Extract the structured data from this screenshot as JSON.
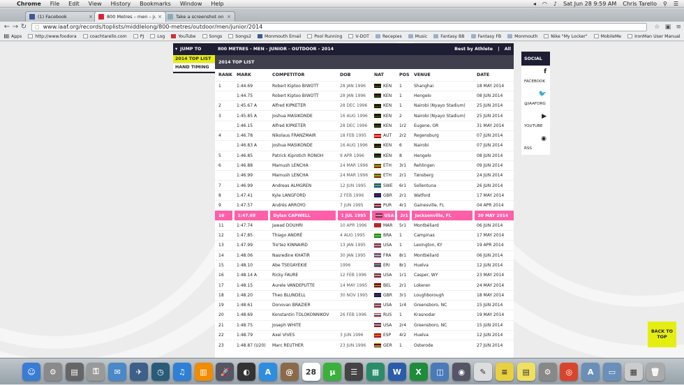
{
  "menubar": {
    "app": "Chrome",
    "items": [
      "File",
      "Edit",
      "View",
      "History",
      "Bookmarks",
      "Window",
      "Help"
    ],
    "datetime": "Sat Jun 28  9:59 AM",
    "user": "Chris Tarello"
  },
  "tabs": [
    {
      "title": "(1) Facebook",
      "color": "#3b5998"
    },
    {
      "title": "800 Metres – men – junior",
      "color": "#d23"
    },
    {
      "title": "Take a screenshot on you",
      "color": "#8ab"
    }
  ],
  "address_bar": {
    "url": "www.iaaf.org/records/toplists/middlelong/800-metres/outdoor/men/junior/2014"
  },
  "bookmarks": [
    {
      "label": "Apps",
      "icon": "grid"
    },
    {
      "label": "http://www.foodora",
      "icon": "page"
    },
    {
      "label": "coachtarello.com",
      "icon": "page"
    },
    {
      "label": "PJ",
      "icon": "page"
    },
    {
      "label": "Log",
      "icon": "page"
    },
    {
      "label": "YouTube",
      "icon": "red"
    },
    {
      "label": "Songs",
      "icon": "page"
    },
    {
      "label": "Songs2",
      "icon": "page"
    },
    {
      "label": "Monmouth Email",
      "icon": "blue"
    },
    {
      "label": "Pool Running",
      "icon": "page"
    },
    {
      "label": "V-DOT",
      "icon": "page"
    },
    {
      "label": "Recepies",
      "icon": "folder"
    },
    {
      "label": "Music",
      "icon": "folder"
    },
    {
      "label": "Fantasy BB",
      "icon": "folder"
    },
    {
      "label": "Fantasy FB",
      "icon": "folder"
    },
    {
      "label": "Monmouth",
      "icon": "folder"
    },
    {
      "label": "Nike \"My Locker\"",
      "icon": "page"
    },
    {
      "label": "MobileMe",
      "icon": "page"
    },
    {
      "label": "IronMan User Manual",
      "icon": "page"
    },
    {
      "label": "Paleo",
      "icon": "folder"
    }
  ],
  "jump": {
    "heading": "JUMP TO",
    "items": [
      "2014 TOP LIST",
      "HAND TIMING"
    ]
  },
  "page": {
    "title": "800 METRES - MEN - JUNIOR - OUTDOOR - 2014",
    "best_by_athlete": "Best by Athlete",
    "all": "All",
    "section": "2014 TOP LIST"
  },
  "table": {
    "columns": [
      "RANK",
      "MARK",
      "COMPETITOR",
      "DOB",
      "NAT",
      "POS",
      "VENUE",
      "DATE"
    ],
    "rows": [
      {
        "rank": "1",
        "mark": "1:44.69",
        "competitor": "Robert Kiptoo BIWOTT",
        "dob": "28 JAN 1996",
        "nat": "KEN",
        "pos": "1",
        "venue": "Shanghai",
        "date": "18 MAY 2014"
      },
      {
        "rank": "",
        "mark": "1:44.75",
        "competitor": "Robert Kiptoo BIWOTT",
        "dob": "28 JAN 1996",
        "nat": "KEN",
        "pos": "1",
        "venue": "Hengelo",
        "date": "08 JUN 2014"
      },
      {
        "rank": "2",
        "mark": "1:45.67 A",
        "competitor": "Alfred KIPKETER",
        "dob": "28 DEC 1996",
        "nat": "KEN",
        "pos": "1",
        "venue": "Nairobi (Nyayo Stadium)",
        "date": "25 JUN 2014"
      },
      {
        "rank": "3",
        "mark": "1:45.85 A",
        "competitor": "Joshua MASIKONDE",
        "dob": "16 AUG 1996",
        "nat": "KEN",
        "pos": "2",
        "venue": "Nairobi (Nyayo Stadium)",
        "date": "25 JUN 2014"
      },
      {
        "rank": "",
        "mark": "1:46.15",
        "competitor": "Alfred KIPKETER",
        "dob": "28 DEC 1996",
        "nat": "KEN",
        "pos": "1r2",
        "venue": "Eugene, OR",
        "date": "31 MAY 2014"
      },
      {
        "rank": "4",
        "mark": "1:46.78",
        "competitor": "Nikolaus FRANZMAIR",
        "dob": "18 FEB 1995",
        "nat": "AUT",
        "pos": "2r2",
        "venue": "Regensburg",
        "date": "07 JUN 2014"
      },
      {
        "rank": "",
        "mark": "1:46.83 A",
        "competitor": "Joshua MASIKONDE",
        "dob": "16 AUG 1996",
        "nat": "KEN",
        "pos": "6",
        "venue": "Nairobi",
        "date": "07 JUN 2014"
      },
      {
        "rank": "5",
        "mark": "1:46.85",
        "competitor": "Patrick Kiprotich RONOH",
        "dob": "9 APR 1996",
        "nat": "KEN",
        "pos": "8",
        "venue": "Hengelo",
        "date": "08 JUN 2014"
      },
      {
        "rank": "6",
        "mark": "1:46.88",
        "competitor": "Mamush LENCHA",
        "dob": "24 MAR 1996",
        "nat": "ETH",
        "pos": "3r1",
        "venue": "Rehlingen",
        "date": "09 JUN 2014"
      },
      {
        "rank": "",
        "mark": "1:46.99",
        "competitor": "Mamush LENCHA",
        "dob": "24 MAR 1996",
        "nat": "ETH",
        "pos": "2r1",
        "venue": "Tønsberg",
        "date": "24 JUN 2014"
      },
      {
        "rank": "7",
        "mark": "1:46.99",
        "competitor": "Andreas ALMGREN",
        "dob": "12 JUN 1995",
        "nat": "SWE",
        "pos": "6r1",
        "venue": "Sollentuna",
        "date": "26 JUN 2014"
      },
      {
        "rank": "8",
        "mark": "1:47.41",
        "competitor": "Kyle LANGFORD",
        "dob": "2 FEB 1996",
        "nat": "GBR",
        "pos": "2r1",
        "venue": "Watford",
        "date": "17 MAY 2014"
      },
      {
        "rank": "9",
        "mark": "1:47.57",
        "competitor": "Andrés ARROYO",
        "dob": "7 JUN 1995",
        "nat": "PUR",
        "pos": "4r1",
        "venue": "Gainesville, FL",
        "date": "04 APR 2014"
      },
      {
        "rank": "10",
        "mark": "1:47.68",
        "competitor": "Dylan CAPWELL",
        "dob": "1 JUL 1995",
        "nat": "USA",
        "pos": "2r1",
        "venue": "Jacksonville, FL",
        "date": "30 MAY 2014",
        "highlight": true
      },
      {
        "rank": "11",
        "mark": "1:47.74",
        "competitor": "Jawad DOUHRI",
        "dob": "10 APR 1996",
        "nat": "MAR",
        "pos": "5r1",
        "venue": "Montbéliard",
        "date": "06 JUN 2014"
      },
      {
        "rank": "12",
        "mark": "1:47.85",
        "competitor": "Thiago ANDRÉ",
        "dob": "4 AUG 1995",
        "nat": "BRA",
        "pos": "1",
        "venue": "Campinas",
        "date": "17 MAY 2014"
      },
      {
        "rank": "13",
        "mark": "1:47.99",
        "competitor": "Tre'tez KINNAIRD",
        "dob": "13 JAN 1995",
        "nat": "USA",
        "pos": "1",
        "venue": "Lexington, KY",
        "date": "19 APR 2014"
      },
      {
        "rank": "14",
        "mark": "1:48.06",
        "competitor": "Nasredine KHATIR",
        "dob": "30 JAN 1995",
        "nat": "FRA",
        "pos": "8r1",
        "venue": "Montbéliard",
        "date": "06 JUN 2014"
      },
      {
        "rank": "15",
        "mark": "1:48.10",
        "competitor": "Abe TSEGAYEKIE",
        "dob": "1996",
        "nat": "ERI",
        "pos": "8r1",
        "venue": "Huelva",
        "date": "12 JUN 2014"
      },
      {
        "rank": "16",
        "mark": "1:48.14 A",
        "competitor": "Ricky FAURE",
        "dob": "12 FEB 1996",
        "nat": "USA",
        "pos": "1r1",
        "venue": "Casper, WY",
        "date": "23 MAY 2014"
      },
      {
        "rank": "17",
        "mark": "1:48.15",
        "competitor": "Aurele VANDEPUTTE",
        "dob": "14 MAY 1995",
        "nat": "BEL",
        "pos": "2r1",
        "venue": "Lokeren",
        "date": "24 MAY 2014"
      },
      {
        "rank": "18",
        "mark": "1:48.20",
        "competitor": "Theo BLUNDELL",
        "dob": "30 NOV 1995",
        "nat": "GBR",
        "pos": "3r1",
        "venue": "Loughborough",
        "date": "18 MAY 2014"
      },
      {
        "rank": "19",
        "mark": "1:48.61",
        "competitor": "Donovan BRAZIER",
        "dob": "",
        "nat": "USA",
        "pos": "1r4",
        "venue": "Greensboro, NC",
        "date": "15 JUN 2014"
      },
      {
        "rank": "20",
        "mark": "1:48.69",
        "competitor": "Konstantin TOLOKONNIKOV",
        "dob": "26 FEB 1996",
        "nat": "RUS",
        "pos": "1",
        "venue": "Krasnodar",
        "date": "19 MAY 2014"
      },
      {
        "rank": "21",
        "mark": "1:48.75",
        "competitor": "Joseph WHITE",
        "dob": "",
        "nat": "USA",
        "pos": "2r4",
        "venue": "Greensboro, NC",
        "date": "15 JUN 2014"
      },
      {
        "rank": "22",
        "mark": "1:48.79",
        "competitor": "Axel VIVES",
        "dob": "3 JUN 1996",
        "nat": "ESP",
        "pos": "4r2",
        "venue": "Huelva",
        "date": "12 JUN 2014"
      },
      {
        "rank": "23",
        "mark": "1:48.87 (U20)",
        "competitor": "Marc REUTHER",
        "dob": "23 JUN 1996",
        "nat": "GER",
        "pos": "1",
        "venue": "Osterode",
        "date": "27 JUN 2014"
      }
    ]
  },
  "flags": {
    "KEN": [
      "#000",
      "#b00",
      "#060"
    ],
    "AUT": [
      "#d00",
      "#fff",
      "#d00"
    ],
    "ETH": [
      "#080",
      "#ee0",
      "#d00"
    ],
    "SWE": [
      "#069",
      "#fc0",
      "#069"
    ],
    "GBR": [
      "#012169",
      "#c8102e",
      "#012169"
    ],
    "PUR": [
      "#d00",
      "#fff",
      "#036"
    ],
    "USA": [
      "#b22",
      "#fff",
      "#3c3b6e"
    ],
    "MAR": [
      "#c1272d",
      "#c1272d",
      "#c1272d"
    ],
    "BRA": [
      "#093",
      "#fd0",
      "#093"
    ],
    "FRA": [
      "#0055a4",
      "#fff",
      "#ef4135"
    ],
    "ERI": [
      "#4189dd",
      "#12ad2b",
      "#ea0437"
    ],
    "BEL": [
      "#000",
      "#fd0",
      "#e02"
    ],
    "RUS": [
      "#fff",
      "#0039a6",
      "#d52b1e"
    ],
    "ESP": [
      "#c60b1e",
      "#ffc400",
      "#c60b1e"
    ],
    "GER": [
      "#000",
      "#d00",
      "#fc0"
    ]
  },
  "social": {
    "heading": "SOCIAL",
    "items": [
      {
        "label": "FACEBOOK",
        "icon": "facebook-icon",
        "glyph": "f"
      },
      {
        "label": "@IAAFORG",
        "icon": "twitter-icon",
        "glyph": "🐦"
      },
      {
        "label": "YOUTUBE",
        "icon": "youtube-icon",
        "glyph": "▶"
      },
      {
        "label": "RSS",
        "icon": "rss-icon",
        "glyph": "◉"
      }
    ]
  },
  "back_to_top": "BACK TO TOP",
  "dock": [
    {
      "name": "finder",
      "color": "#3a7bd5",
      "glyph": "☺"
    },
    {
      "name": "preview",
      "color": "#8a8a8a",
      "glyph": "⚙"
    },
    {
      "name": "printer",
      "color": "#666",
      "glyph": "▤"
    },
    {
      "name": "keychain",
      "color": "#999",
      "glyph": "⚿"
    },
    {
      "name": "mail",
      "color": "#4a88c7",
      "glyph": "✉"
    },
    {
      "name": "photo",
      "color": "#3d5f8a",
      "glyph": "✈"
    },
    {
      "name": "time-machine",
      "color": "#2a5c7a",
      "glyph": "◷"
    },
    {
      "name": "itunes",
      "color": "#2e7fd6",
      "glyph": "♫"
    },
    {
      "name": "ibooks",
      "color": "#f08c00",
      "glyph": "▥"
    },
    {
      "name": "launchpad",
      "color": "#556",
      "glyph": "🚀"
    },
    {
      "name": "dashboard",
      "color": "#333",
      "glyph": "◐"
    },
    {
      "name": "app-store",
      "color": "#2e8de0",
      "glyph": "A"
    },
    {
      "name": "contacts",
      "color": "#8b6a4a",
      "glyph": "@"
    },
    {
      "name": "calendar",
      "color": "#fff",
      "glyph": "28"
    },
    {
      "name": "utorrent",
      "color": "#3bb03b",
      "glyph": "µ"
    },
    {
      "name": "app",
      "color": "#444",
      "glyph": "☰"
    },
    {
      "name": "image-capture",
      "color": "#2a8c6a",
      "glyph": "▦"
    },
    {
      "name": "word",
      "color": "#2a5caa",
      "glyph": "W"
    },
    {
      "name": "excel",
      "color": "#1e8c3a",
      "glyph": "X"
    },
    {
      "name": "preview2",
      "color": "#4a7ab8",
      "glyph": "◫"
    },
    {
      "name": "facetime",
      "color": "#556",
      "glyph": "◉"
    },
    {
      "name": "textedit",
      "color": "#ddd",
      "glyph": "✎"
    },
    {
      "name": "notes",
      "color": "#e8d040",
      "glyph": "≡"
    },
    {
      "name": "stickies",
      "color": "#f0e060",
      "glyph": "▤"
    },
    {
      "name": "system-prefs",
      "color": "#888",
      "glyph": "⚙"
    },
    {
      "name": "chrome",
      "color": "#d8452d",
      "glyph": "◎"
    },
    {
      "name": "applications",
      "color": "#6a8fb8",
      "glyph": "A"
    },
    {
      "name": "documents",
      "color": "#6a8fb8",
      "glyph": "▭"
    },
    {
      "name": "downloads",
      "color": "#ccc",
      "glyph": "▦"
    },
    {
      "name": "trash",
      "color": "#aaa",
      "glyph": "🗑"
    }
  ]
}
